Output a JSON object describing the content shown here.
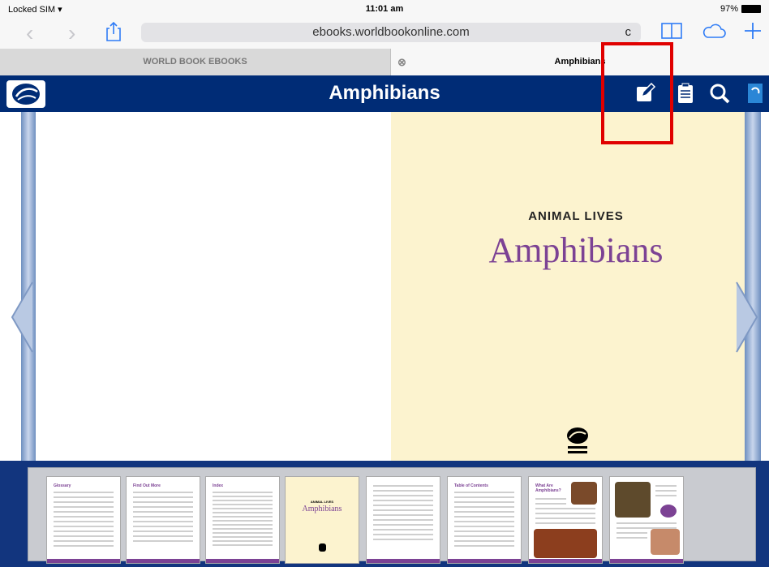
{
  "statusbar": {
    "carrier": "Locked SIM",
    "time": "11:01 am",
    "battery": "97%"
  },
  "browser": {
    "url": "ebooks.worldbookonline.com",
    "reload": "c",
    "tabs": [
      {
        "label": "WORLD BOOK EBOOKS",
        "active": false
      },
      {
        "label": "Amphibians",
        "active": true
      }
    ],
    "tab_close": "⊗"
  },
  "header": {
    "title": "Amphibians"
  },
  "book": {
    "series": "ANIMAL LIVES",
    "title": "Amphibians"
  },
  "thumbnails": [
    {
      "heading": "Glossary"
    },
    {
      "heading": "Find Out More"
    },
    {
      "heading": "Index"
    },
    {
      "heading": "ANIMAL LIVES",
      "subheading": "Amphibians"
    },
    {
      "heading": ""
    },
    {
      "heading": "Table of Contents"
    },
    {
      "heading": "What Are Amphibians?"
    },
    {
      "heading": ""
    }
  ],
  "colors": {
    "header": "#002c76",
    "cover": "#fcf3cf",
    "title": "#7c4294",
    "highlight": "#e00000"
  }
}
